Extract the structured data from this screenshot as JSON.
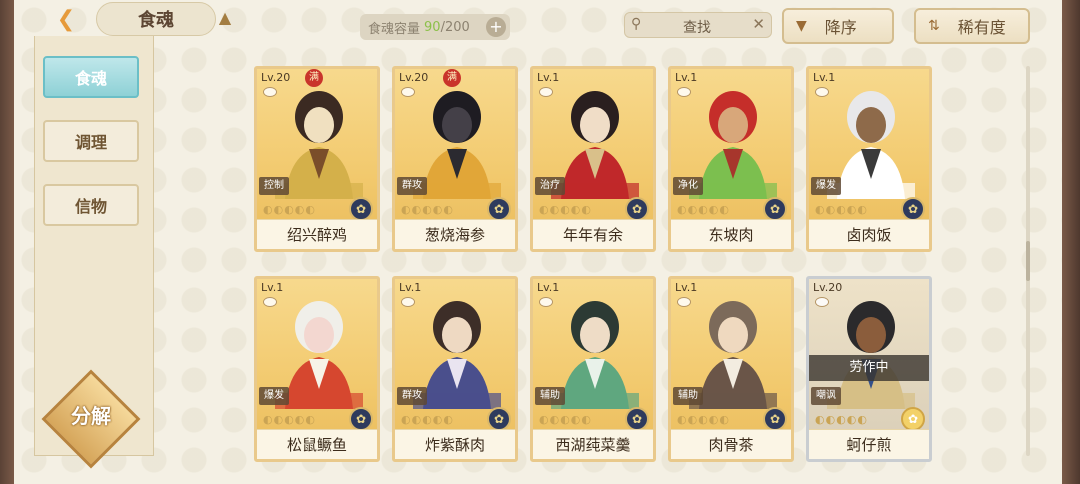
{
  "header": {
    "title": "食魂",
    "capacity_label": "食魂容量",
    "capacity_current": "90",
    "capacity_max": "/200",
    "search_placeholder": "查找",
    "sort_order_label": "降序",
    "sort_by_label": "稀有度"
  },
  "sidebar": {
    "tabs": [
      {
        "label": "食魂",
        "active": true
      },
      {
        "label": "调理",
        "active": false
      },
      {
        "label": "信物",
        "active": false
      }
    ],
    "decompose_label": "分解"
  },
  "cards": [
    {
      "level": "Lv.20",
      "full": "满",
      "role": "控制",
      "name": "绍兴醉鸡",
      "palette": [
        "#3b2a22",
        "#f0e0c0",
        "#d4b04a",
        "#7a4e2a"
      ]
    },
    {
      "level": "Lv.20",
      "full": "满",
      "role": "群攻",
      "name": "葱烧海参",
      "palette": [
        "#1e1c22",
        "#444048",
        "#e1a638",
        "#2b2a30"
      ]
    },
    {
      "level": "Lv.1",
      "full": "",
      "role": "治疗",
      "name": "年年有余",
      "palette": [
        "#2a1f1f",
        "#f0ddc7",
        "#c0282a",
        "#d9c08a"
      ]
    },
    {
      "level": "Lv.1",
      "full": "",
      "role": "净化",
      "name": "东坡肉",
      "palette": [
        "#c52e2a",
        "#d8a77a",
        "#7cbf4f",
        "#a7362c"
      ]
    },
    {
      "level": "Lv.1",
      "full": "",
      "role": "爆发",
      "name": "卤肉饭",
      "palette": [
        "#e8e8ea",
        "#8e6a4a",
        "#ffffff",
        "#3a3a3a"
      ]
    },
    {
      "level": "Lv.1",
      "full": "",
      "role": "爆发",
      "name": "松鼠鳜鱼",
      "palette": [
        "#f0efe9",
        "#f3d7d0",
        "#d6472f",
        "#f7f3e7"
      ]
    },
    {
      "level": "Lv.1",
      "full": "",
      "role": "群攻",
      "name": "炸紫酥肉",
      "palette": [
        "#3d2e28",
        "#eed9c2",
        "#4a4f8c",
        "#e9e4f0"
      ]
    },
    {
      "level": "Lv.1",
      "full": "",
      "role": "辅助",
      "name": "西湖莼菜羹",
      "palette": [
        "#2c3a34",
        "#eedcc6",
        "#5fa77f",
        "#e9f2ea"
      ]
    },
    {
      "level": "Lv.1",
      "full": "",
      "role": "辅助",
      "name": "肉骨茶",
      "palette": [
        "#7c6a5a",
        "#efd9bf",
        "#6a5548",
        "#f3ece0"
      ]
    },
    {
      "level": "Lv.20",
      "full": "",
      "role": "嘲讽",
      "name": "蚵仔煎",
      "working": "劳作中",
      "grey": true,
      "palette": [
        "#2b2a2c",
        "#8b5d3c",
        "#d6bf86",
        "#33508a"
      ]
    }
  ]
}
